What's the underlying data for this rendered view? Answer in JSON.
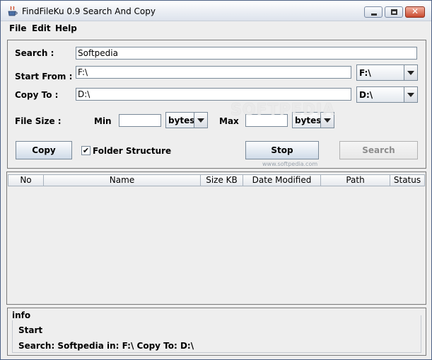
{
  "window": {
    "title": "FindFileKu 0.9 Search And Copy",
    "close_glyph": "✕"
  },
  "menu": [
    "File",
    "Edit",
    "Help"
  ],
  "form": {
    "search_label": "Search :",
    "search_value": "Softpedia",
    "start_from_label": "Start From :",
    "start_from_value": "F:\\",
    "start_from_drive": "F:\\",
    "copy_to_label": "Copy To :",
    "copy_to_value": "D:\\",
    "copy_to_drive": "D:\\",
    "file_size_label": "File Size :",
    "min_label": "Min",
    "min_value": "",
    "min_unit": "bytes",
    "max_label": "Max",
    "max_value": "",
    "max_unit": "bytes",
    "copy_button": "Copy",
    "folder_structure_label": "Folder Structure",
    "folder_structure_checked": true,
    "checkmark": "✔",
    "stop_button": "Stop",
    "search_button": "Search"
  },
  "watermark": {
    "text": "SOFTPEDIA",
    "url": "www.softpedia.com"
  },
  "table": {
    "columns": [
      "No",
      "Name",
      "Size KB",
      "Date Modified",
      "Path",
      "Status"
    ],
    "rows": []
  },
  "info": {
    "title": "info",
    "line1": "Start",
    "line2": "Search: Softpedia in: F:\\   Copy To: D:\\"
  }
}
